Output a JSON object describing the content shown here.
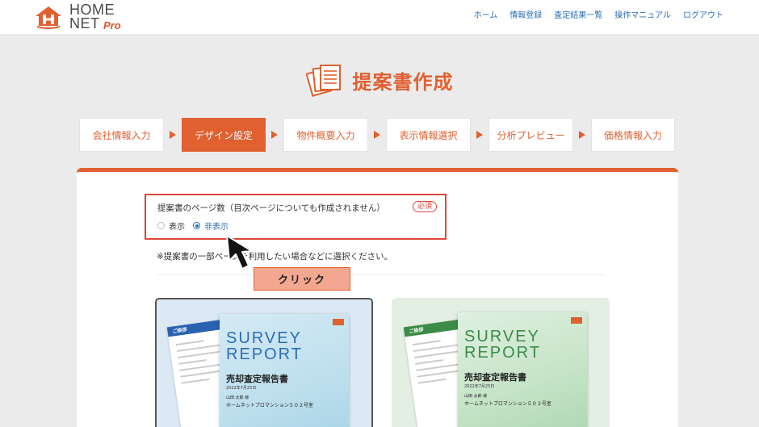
{
  "brand": {
    "line1": "HOME",
    "line2": "NET",
    "pro": "Pro",
    "mark_letter": "H"
  },
  "nav": [
    {
      "label": "ホーム"
    },
    {
      "label": "情報登録"
    },
    {
      "label": "査定結果一覧"
    },
    {
      "label": "操作マニュアル"
    },
    {
      "label": "ログアウト"
    }
  ],
  "page_title": "提案書作成",
  "steps": [
    {
      "label": "会社情報入力",
      "active": false
    },
    {
      "label": "デザイン設定",
      "active": true
    },
    {
      "label": "物件概要入力",
      "active": false
    },
    {
      "label": "表示情報選択",
      "active": false
    },
    {
      "label": "分析プレビュー",
      "active": false
    },
    {
      "label": "価格情報入力",
      "active": false
    }
  ],
  "toc_setting": {
    "label": "提案書のページ数（目次ページについても作成されません）",
    "required_badge": "必須",
    "options": [
      {
        "label": "表示",
        "selected": false
      },
      {
        "label": "非表示",
        "selected": true
      }
    ]
  },
  "note": "※提案書の一部ページを利用したい場合などに選択ください。",
  "click_annotation": "クリック",
  "colors": {
    "accent": "#e06030",
    "link": "#2a6db5",
    "highlight": "#e0453a"
  },
  "designs": [
    {
      "theme": "blue",
      "back_header": "ご挨拶",
      "survey": "SURVEY",
      "report": "REPORT",
      "title": "売却査定報告書",
      "date": "2022年7月25日",
      "addressee": "山田 太郎 様",
      "company": "ホームネットプロマンション５０２号室"
    },
    {
      "theme": "green",
      "back_header": "ご挨拶",
      "survey": "SURVEY",
      "report": "REPORT",
      "title": "売却査定報告書",
      "date": "2022年7月25日",
      "addressee": "山田 太郎 様",
      "company": "ホームネットプロマンション５０２号室"
    }
  ]
}
